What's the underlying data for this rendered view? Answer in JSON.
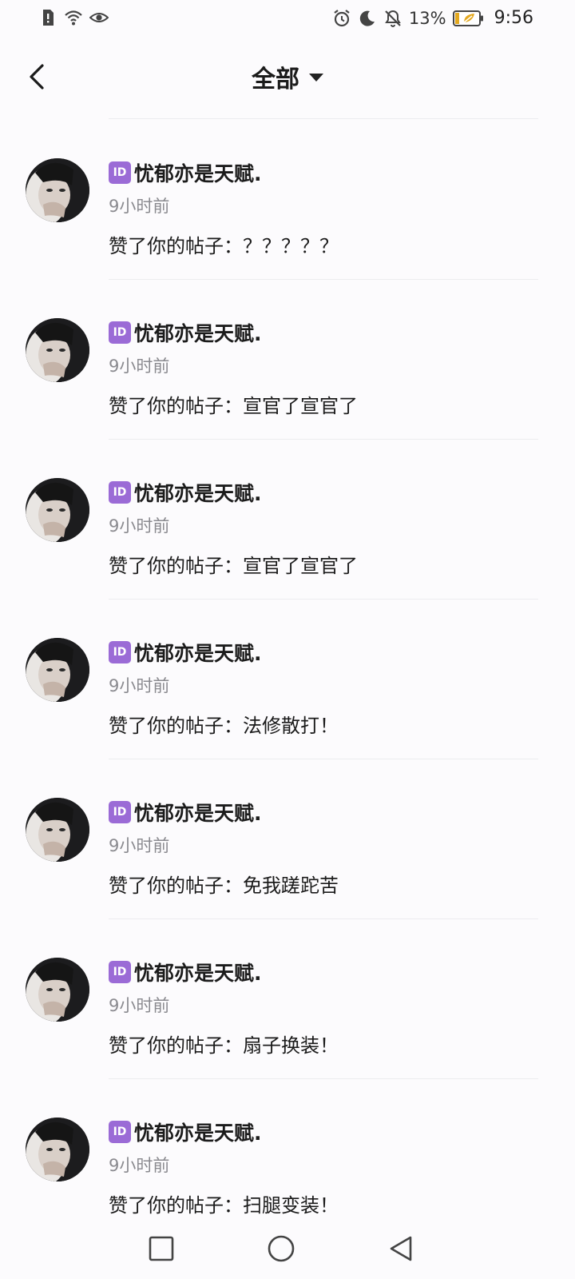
{
  "status_bar": {
    "battery": "13%",
    "time": "9:56",
    "icons_left": [
      "alert-icon",
      "wifi-icon",
      "eye-icon"
    ],
    "icons_right": [
      "alarm-icon",
      "moon-icon",
      "bell-off-icon",
      "battery-icon"
    ]
  },
  "header": {
    "title": "全部",
    "back_icon": "chevron-left-icon",
    "dropdown_icon": "caret-down-icon"
  },
  "colors": {
    "badge": "#9b6bd6",
    "secondary_text": "#8a8a8f",
    "background": "#fcfbfd"
  },
  "notifications": [
    {
      "badge": "ID",
      "username": "忧郁亦是天赋.",
      "time": "9小时前",
      "action": "赞了你的帖子：？？？？？"
    },
    {
      "badge": "ID",
      "username": "忧郁亦是天赋.",
      "time": "9小时前",
      "action": "赞了你的帖子：宣官了宣官了"
    },
    {
      "badge": "ID",
      "username": "忧郁亦是天赋.",
      "time": "9小时前",
      "action": "赞了你的帖子：宣官了宣官了"
    },
    {
      "badge": "ID",
      "username": "忧郁亦是天赋.",
      "time": "9小时前",
      "action": "赞了你的帖子：法修散打！"
    },
    {
      "badge": "ID",
      "username": "忧郁亦是天赋.",
      "time": "9小时前",
      "action": "赞了你的帖子：免我蹉跎苦"
    },
    {
      "badge": "ID",
      "username": "忧郁亦是天赋.",
      "time": "9小时前",
      "action": "赞了你的帖子：扇子换装！"
    },
    {
      "badge": "ID",
      "username": "忧郁亦是天赋.",
      "time": "9小时前",
      "action": "赞了你的帖子：扫腿变装！"
    }
  ],
  "nav": {
    "buttons": [
      "recents-square-icon",
      "home-circle-icon",
      "back-triangle-icon"
    ]
  }
}
